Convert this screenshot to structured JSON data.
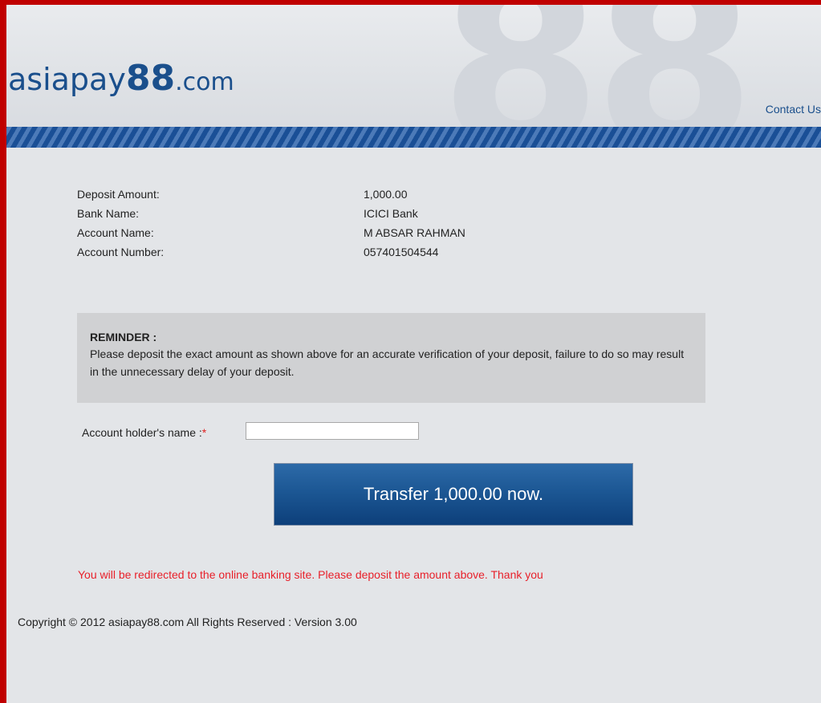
{
  "header": {
    "logo_part1": "asiapay",
    "logo_part2": "88",
    "logo_part3": ".com",
    "background_text": "88",
    "contact_link": "Contact Us"
  },
  "details": [
    {
      "label": "Deposit Amount:",
      "value": "1,000.00"
    },
    {
      "label": "Bank Name:",
      "value": "ICICI Bank"
    },
    {
      "label": "Account Name:",
      "value": "M ABSAR RAHMAN"
    },
    {
      "label": "Account Number:",
      "value": "057401504544"
    }
  ],
  "reminder": {
    "title": "REMINDER :",
    "text": "Please deposit the exact amount as shown above for an accurate verification of your deposit, failure to do so may result in the unnecessary delay of your deposit."
  },
  "form": {
    "holder_label": "Account holder's name :",
    "required_mark": "*",
    "holder_value": ""
  },
  "button": {
    "label": "Transfer  1,000.00 now."
  },
  "notice": "You will be redirected to the online banking site. Please deposit the amount above. Thank you",
  "footer": {
    "copyright": "Copyright © 2012 asiapay88.com All Rights Reserved : Version 3.00"
  },
  "colors": {
    "frame_border": "#c00000",
    "brand_blue": "#1a4f8c",
    "button_blue": "#1c5794",
    "notice_red": "#e8202a",
    "page_background": "#e3e5e8"
  }
}
